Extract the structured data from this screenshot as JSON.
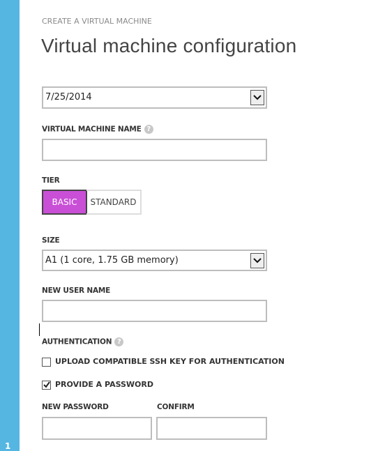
{
  "wizard": {
    "step": "1",
    "subtitle": "CREATE A VIRTUAL MACHINE",
    "title": "Virtual machine configuration"
  },
  "version_select": {
    "value": "7/25/2014"
  },
  "vm_name": {
    "label": "VIRTUAL MACHINE NAME",
    "value": ""
  },
  "tier": {
    "label": "TIER",
    "options": [
      "BASIC",
      "STANDARD"
    ],
    "selected": "BASIC",
    "accent": "#c94fd6"
  },
  "size": {
    "label": "SIZE",
    "value": "A1 (1 core, 1.75 GB memory)"
  },
  "user_name": {
    "label": "NEW USER NAME",
    "value": ""
  },
  "authentication": {
    "label": "AUTHENTICATION",
    "options": [
      {
        "label": "UPLOAD COMPATIBLE SSH KEY FOR AUTHENTICATION",
        "checked": false
      },
      {
        "label": "PROVIDE A PASSWORD",
        "checked": true
      }
    ]
  },
  "password": {
    "label": "NEW PASSWORD",
    "value": ""
  },
  "confirm": {
    "label": "CONFIRM",
    "value": ""
  },
  "colors": {
    "sidebar": "#55b6e2"
  }
}
